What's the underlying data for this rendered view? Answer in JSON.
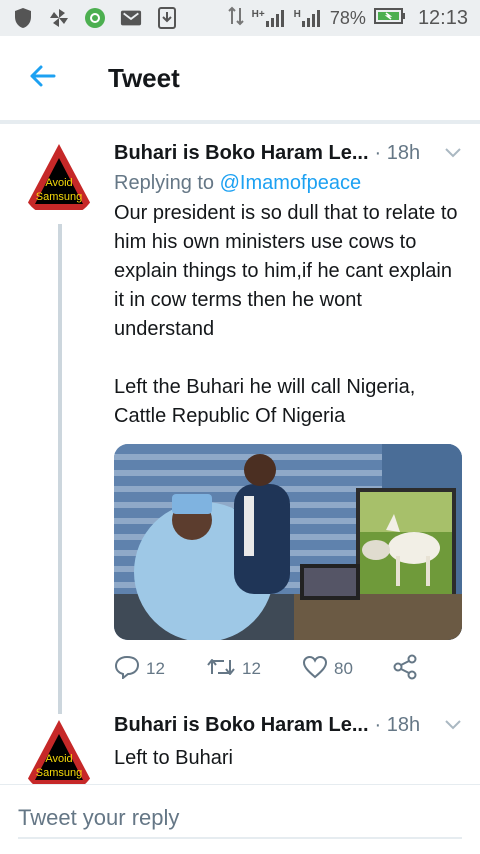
{
  "status_bar": {
    "battery": "78%",
    "time": "12:13",
    "network_1": "H+",
    "network_2": "H"
  },
  "header": {
    "back_icon": "back-arrow-icon",
    "title": "Tweet"
  },
  "colors": {
    "accent": "#1da1f2",
    "secondary_text": "#657786",
    "primary_text": "#14171a"
  },
  "tweets": [
    {
      "author": "Buhari is Boko Haram Le...",
      "time": "· 18h",
      "replying_label": "Replying to",
      "replying_handle": "@Imamofpeace",
      "text": "Our president is so dull that to relate to him his own ministers use cows to explain things to him,if he cant explain it in cow terms then he wont understand\n\nLeft the Buhari he will call Nigeria, Cattle Republic Of Nigeria",
      "avatar_text_1": "Avoid",
      "avatar_text_2": "Samsung",
      "actions": {
        "replies": "12",
        "retweets": "12",
        "likes": "80"
      }
    },
    {
      "author": "Buhari is Boko Haram Le...",
      "time": "· 18h",
      "text": "Left to Buhari",
      "avatar_text_1": "Avoid",
      "avatar_text_2": "Samsung"
    }
  ],
  "composer": {
    "placeholder": "Tweet your reply"
  }
}
